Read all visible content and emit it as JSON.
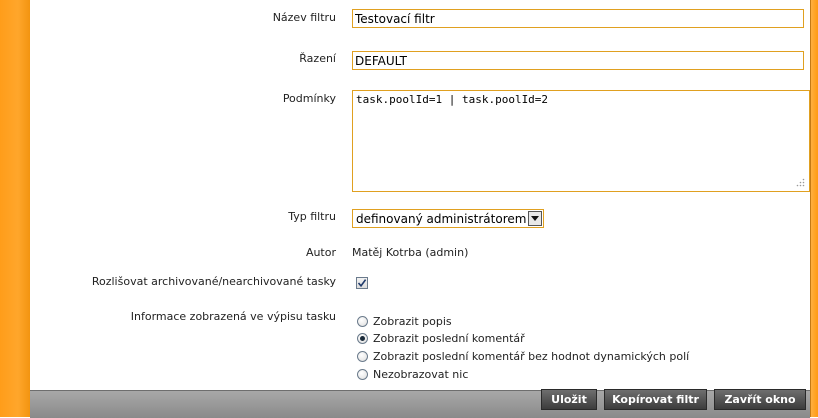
{
  "form": {
    "name_label": "Název filtru",
    "name_value": "Testovací filtr",
    "order_label": "Řazení",
    "order_value": "DEFAULT",
    "conditions_label": "Podmínky",
    "conditions_value": "task.poolId=1 | task.poolId=2",
    "type_label": "Typ filtru",
    "type_selected": "definovaný administrátorem",
    "author_label": "Autor",
    "author_value": "Matěj Kotrba (admin)",
    "archive_label": "Rozlišovat archivované/nearchivované tasky",
    "archive_checked": true,
    "info_label": "Informace zobrazená ve výpisu tasku",
    "info_options": [
      {
        "label": "Zobrazit popis",
        "checked": false
      },
      {
        "label": "Zobrazit poslední komentář",
        "checked": true
      },
      {
        "label": "Zobrazit poslední komentář bez hodnot dynamických polí",
        "checked": false
      },
      {
        "label": "Nezobrazovat nic",
        "checked": false
      }
    ]
  },
  "footer": {
    "save_label": "Uložit",
    "copy_label": "Kopírovat filtr",
    "close_label": "Zavřít okno"
  },
  "colors": {
    "frame_orange": "#ff9d1a",
    "field_border": "#e0a020",
    "button_dark": "#4a4a4a"
  }
}
